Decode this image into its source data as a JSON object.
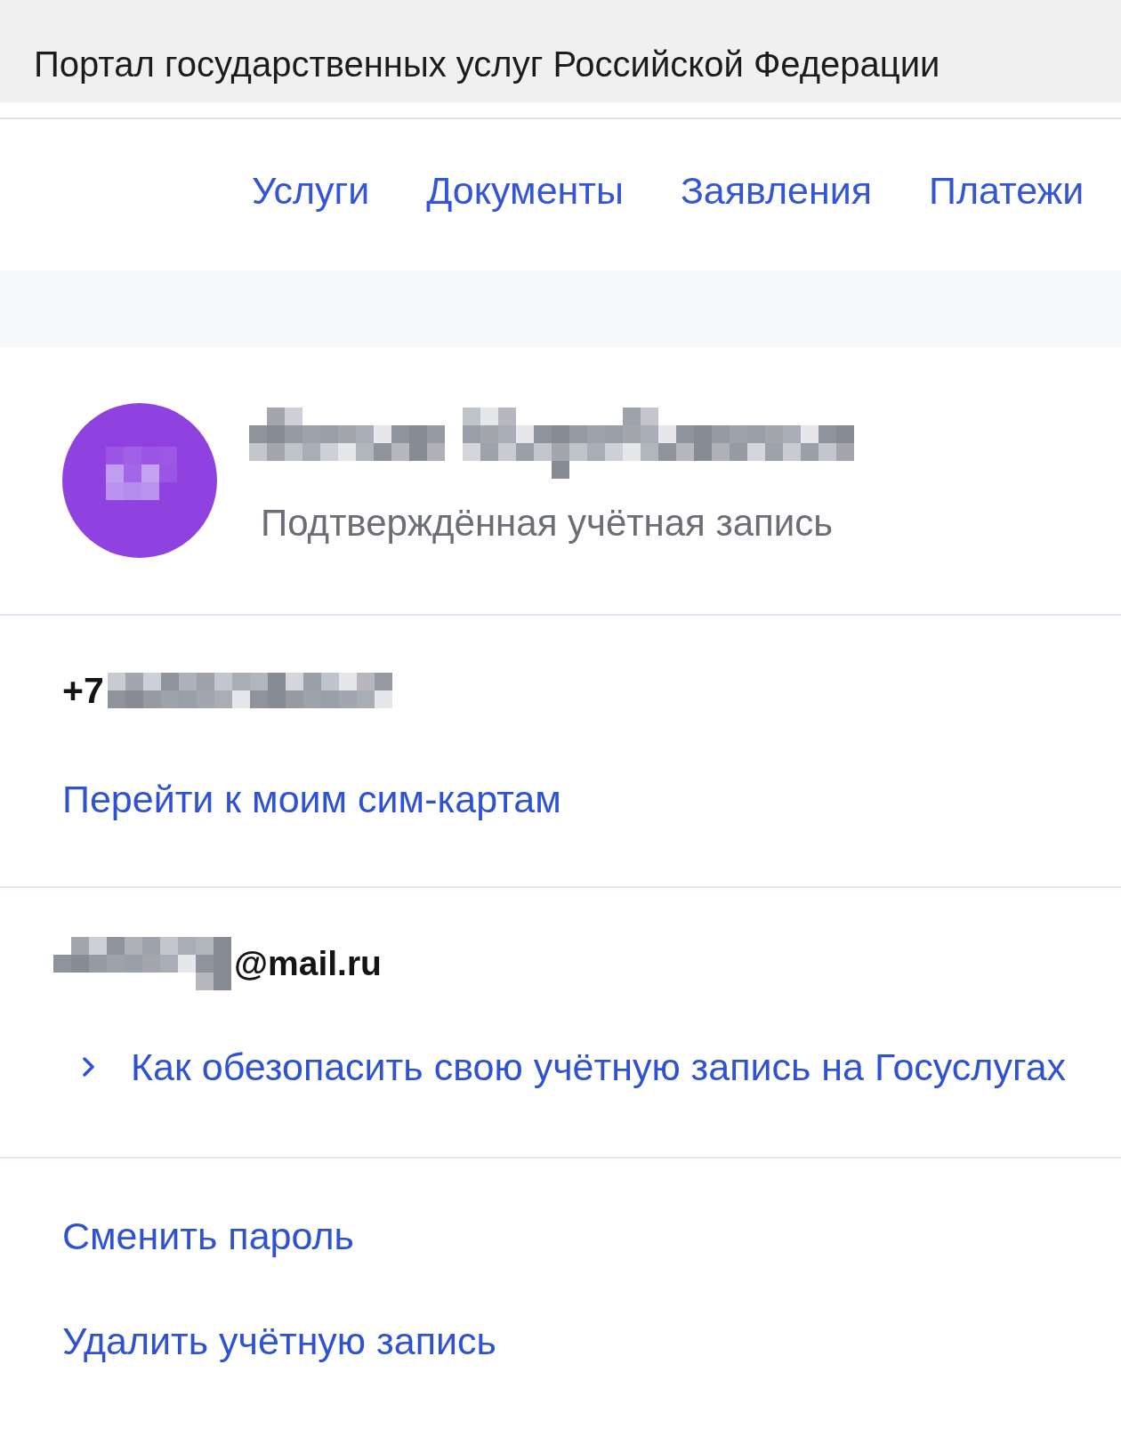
{
  "header": {
    "title": "Портал государственных услуг Российской Федерации"
  },
  "nav": [
    {
      "label": "Услуги"
    },
    {
      "label": "Документы"
    },
    {
      "label": "Заявления"
    },
    {
      "label": "Платежи"
    }
  ],
  "profile": {
    "status": "Подтверждённая учётная запись"
  },
  "phone": {
    "prefix": "+7",
    "link": "Перейти к моим сим-картам"
  },
  "email": {
    "domain": "@mail.ru",
    "link": "Как обезопасить свою учётную запись на Госуслугах"
  },
  "actions": [
    {
      "label": "Сменить пароль"
    },
    {
      "label": "Удалить учётную запись"
    }
  ]
}
